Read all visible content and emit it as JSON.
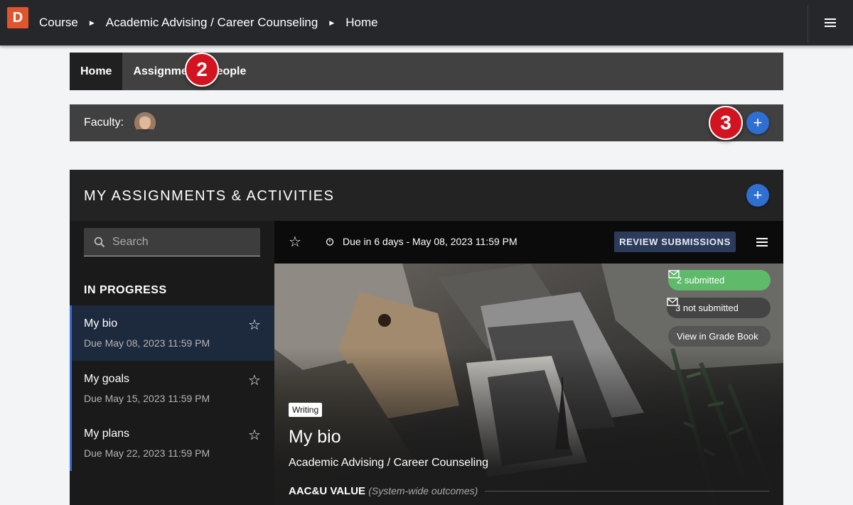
{
  "topbar": {
    "logo": "D",
    "breadcrumbs": [
      "Course",
      "Academic Advising / Career Counseling",
      "Home"
    ],
    "menu_icon": "hamburger-icon"
  },
  "nav": {
    "tabs": [
      {
        "label": "Home",
        "active": true
      },
      {
        "label": "Assignme",
        "active": false
      },
      {
        "label": "People",
        "active": false
      }
    ]
  },
  "faculty": {
    "label": "Faculty:"
  },
  "callouts": {
    "two": "2",
    "three": "3"
  },
  "panel": {
    "title": "MY ASSIGNMENTS & ACTIVITIES",
    "add_symbol": "+"
  },
  "sidebar": {
    "search_placeholder": "Search",
    "section": "IN PROGRESS",
    "items": [
      {
        "title": "My bio",
        "due": "Due May 08, 2023 11:59 PM",
        "active": true
      },
      {
        "title": "My goals",
        "due": "Due May 15, 2023 11:59 PM",
        "active": false
      },
      {
        "title": "My plans",
        "due": "Due May 22, 2023 11:59 PM",
        "active": false
      }
    ]
  },
  "detail": {
    "due_text": "Due in 6 days - May 08, 2023 11:59 PM",
    "review_button": "REVIEW SUBMISSIONS",
    "submitted": "2 submitted",
    "not_submitted": "3 not submitted",
    "grade_book": "View in Grade Book",
    "tag": "Writing",
    "title": "My bio",
    "course": "Academic Advising / Career Counseling",
    "aacu_label": "AAC&U VALUE",
    "aacu_sub": "(System-wide outcomes)"
  },
  "colors": {
    "accent_blue": "#2f6fd1",
    "callout_red": "#d1141f",
    "submitted_green": "#5fbb6a",
    "logo_orange": "#e0552e"
  }
}
